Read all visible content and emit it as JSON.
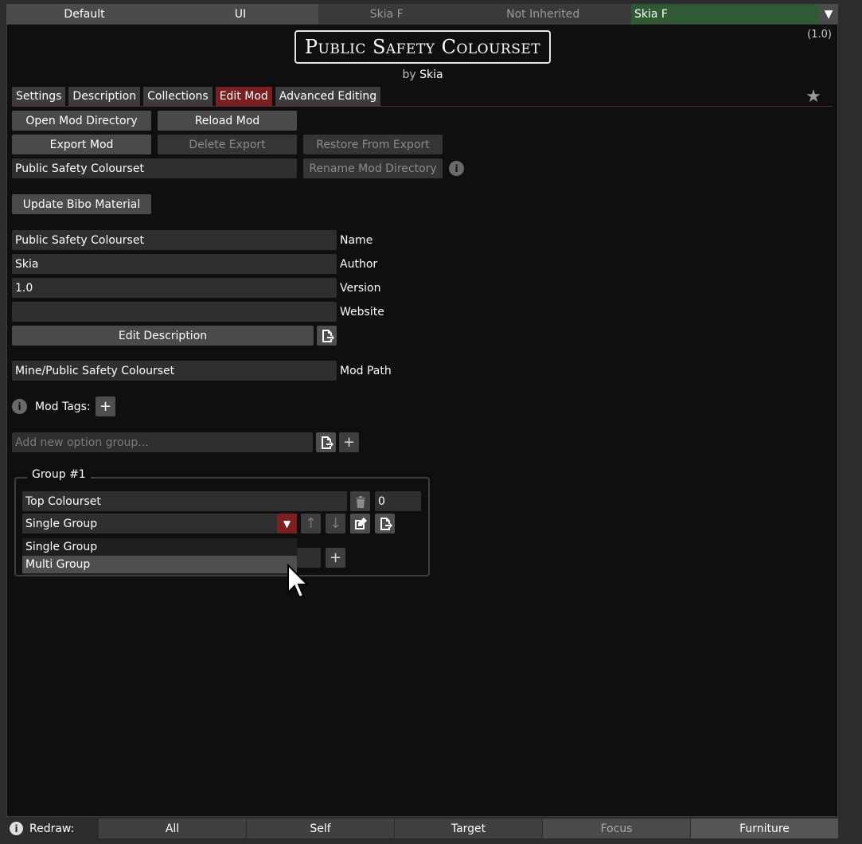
{
  "collections": {
    "default": "Default",
    "ui": "UI",
    "inherited_name": "Skia F",
    "inherited_status": "Not Inherited",
    "current": "Skia F"
  },
  "header": {
    "title": "Public Safety Colourset",
    "by": "by",
    "author": "Skia",
    "version": "(1.0)"
  },
  "tabs": [
    {
      "label": "Settings"
    },
    {
      "label": "Description"
    },
    {
      "label": "Collections"
    },
    {
      "label": "Edit Mod",
      "active": true
    },
    {
      "label": "Advanced Editing"
    }
  ],
  "actions": {
    "open_dir": "Open Mod Directory",
    "reload": "Reload Mod",
    "export": "Export Mod",
    "delete_export": "Delete Export",
    "restore_export": "Restore From Export",
    "dir_name_value": "Public Safety Colourset",
    "rename_dir": "Rename Mod Directory",
    "update_bibo": "Update Bibo Material"
  },
  "meta": {
    "name_value": "Public Safety Colourset",
    "name_label": "Name",
    "author_value": "Skia",
    "author_label": "Author",
    "version_value": "1.0",
    "version_label": "Version",
    "website_value": "",
    "website_label": "Website",
    "edit_description": "Edit Description",
    "mod_path_value": "Mine/Public Safety Colourset",
    "mod_path_label": "Mod Path",
    "mod_tags_label": "Mod Tags:"
  },
  "option_group": {
    "new_placeholder": "Add new option group...",
    "legend": "Group #1",
    "group_name": "Top Colourset",
    "priority": "0",
    "group_type": "Single Group",
    "type_options": [
      "Single Group",
      "Multi Group"
    ],
    "hovered_option": "Multi Group"
  },
  "redraw": {
    "label": "Redraw:",
    "buttons": [
      "All",
      "Self",
      "Target",
      "Focus",
      "Furniture"
    ]
  },
  "colors": {
    "accent_red": "#7a2020",
    "collection_green": "#2f5a33"
  }
}
